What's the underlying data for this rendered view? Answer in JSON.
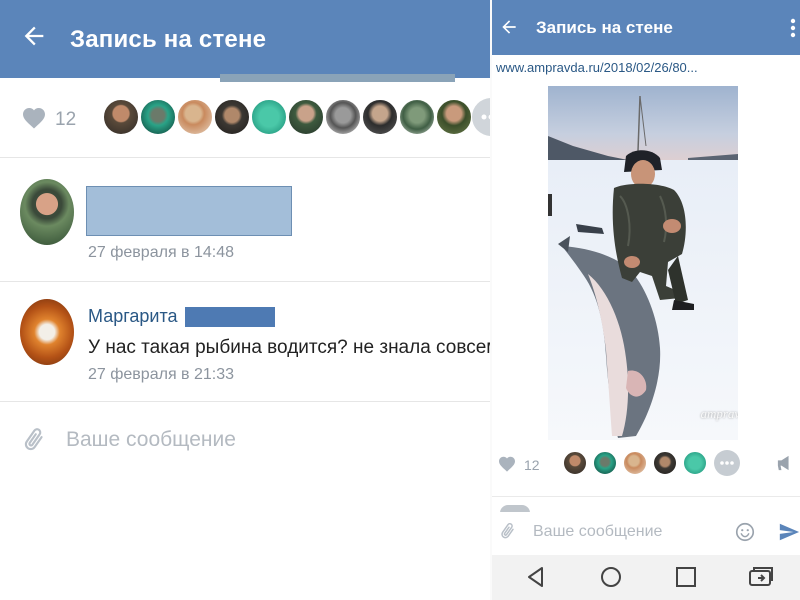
{
  "left_panel": {
    "header": {
      "title": "Запись на стене"
    },
    "likes": {
      "count": "12"
    },
    "comments": [
      {
        "author": "",
        "time": "27 февраля в 14:48"
      },
      {
        "author": "Маргарита",
        "text": "У нас такая рыбина водится? не знала совсем",
        "time": "27 февраля в 21:33"
      }
    ],
    "compose": {
      "placeholder": "Ваше сообщение"
    }
  },
  "right_panel": {
    "header": {
      "title": "Запись на стене"
    },
    "link": "www.ampravda.ru/2018/02/26/80...",
    "photo": {
      "watermark": "ampravda.ru"
    },
    "likes": {
      "count": "12"
    },
    "compose": {
      "placeholder": "Ваше сообщение"
    }
  },
  "icons": {
    "back": "back-arrow-icon",
    "like": "heart-icon",
    "attach": "paperclip-icon",
    "more": "more-dots-icon",
    "share": "megaphone-icon",
    "emoji": "smile-icon",
    "send": "send-icon",
    "menu": "vertical-dots-icon"
  },
  "colors": {
    "header": "#5b85ba",
    "link": "#2a5885",
    "muted": "#8c949e"
  }
}
